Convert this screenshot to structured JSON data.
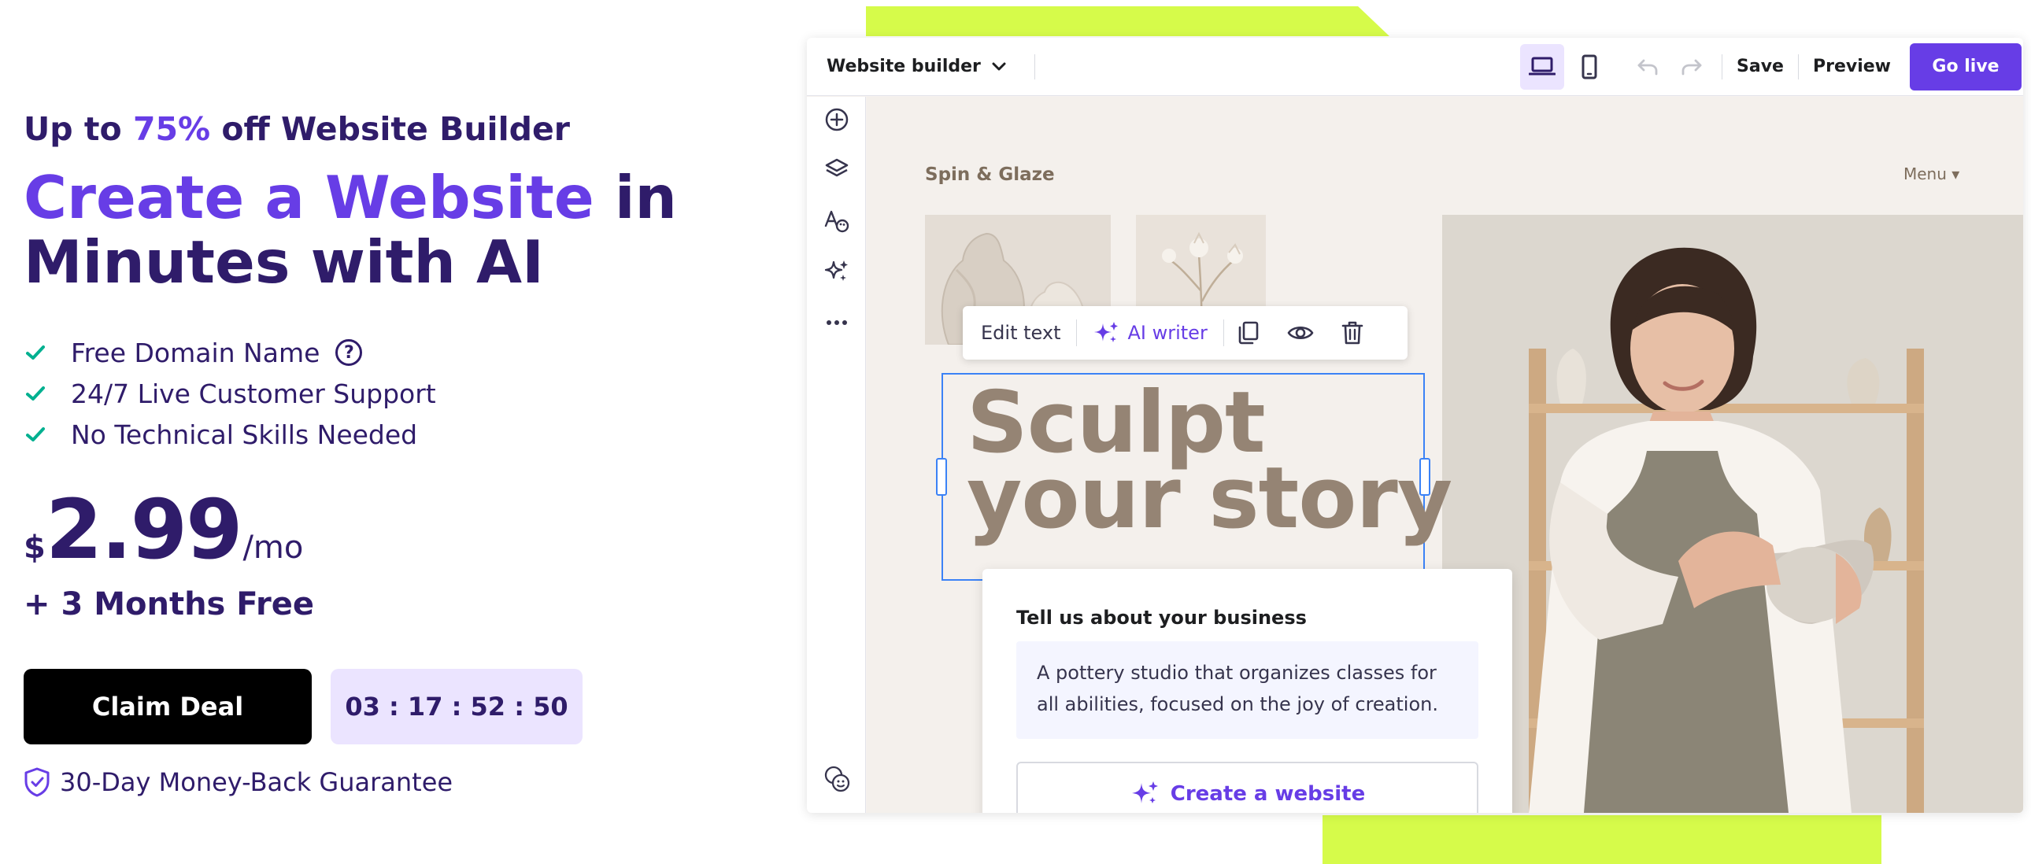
{
  "promo": {
    "eyebrow_prefix": "Up to ",
    "eyebrow_accent": "75%",
    "eyebrow_suffix": " off Website Builder",
    "headline_accent": "Create a Website",
    "headline_rest_1": " in",
    "headline_rest_2": "Minutes with AI",
    "features": [
      "Free Domain Name",
      "24/7 Live Customer Support",
      "No Technical Skills Needed"
    ],
    "feature_help_glyph": "?",
    "price_currency": "$",
    "price_amount": "2.99",
    "price_period": "/mo",
    "bonus": "+ 3 Months Free",
    "cta_label": "Claim Deal",
    "countdown": "03 : 17 : 52 : 50",
    "guarantee": "30-Day Money-Back Guarantee"
  },
  "editor": {
    "topbar": {
      "builder_label": "Website builder",
      "save": "Save",
      "preview": "Preview",
      "go_live": "Go live"
    },
    "sidebar_icons": [
      "add-icon",
      "layers-icon",
      "styles-icon",
      "ai-tools-icon",
      "more-icon",
      "accessibility-icon"
    ],
    "canvas": {
      "brand": "Spin & Glaze",
      "menu": "Menu ▾",
      "toolbar": {
        "edit_text": "Edit text",
        "ai_writer": "AI writer"
      },
      "heading_line1": "Sculpt",
      "heading_line2": "your story",
      "business_card": {
        "label": "Tell us about your business",
        "description": "A pottery studio that organizes classes for all abilities, focused on the joy of creation.",
        "create_button": "Create a website"
      }
    }
  },
  "colors": {
    "accent": "#673de6",
    "navy": "#2f1c6a",
    "lime": "#d6fb4a",
    "check_green": "#00b090",
    "heading_taupe": "#958474"
  }
}
